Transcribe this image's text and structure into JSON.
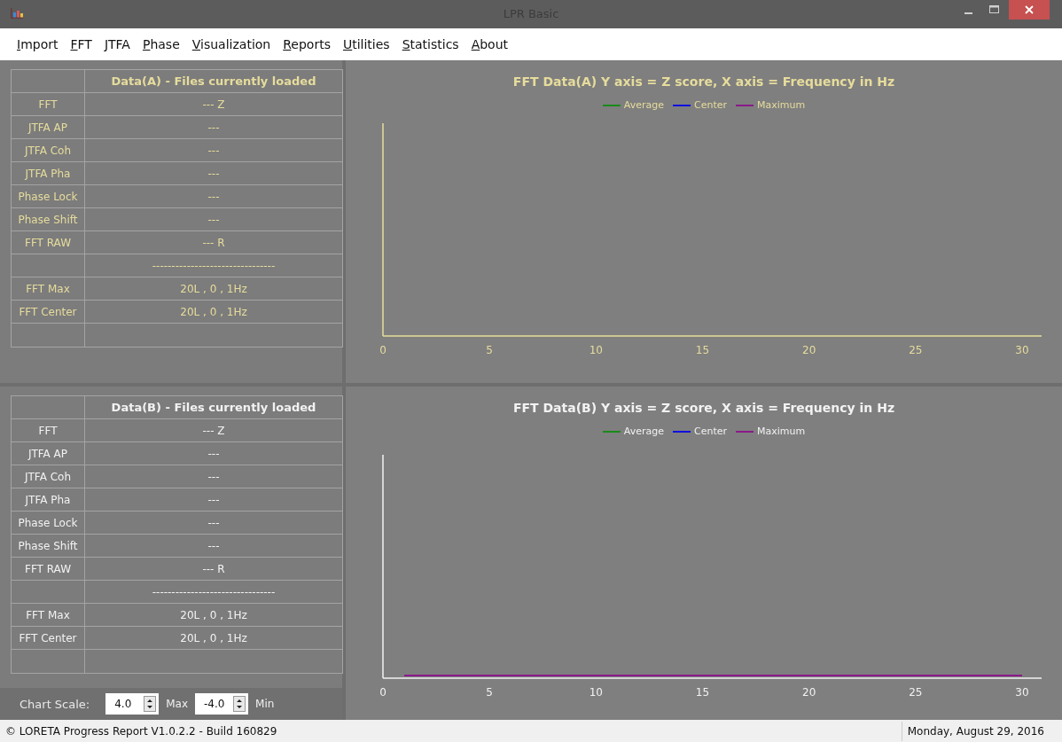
{
  "window": {
    "title": "LPR Basic"
  },
  "menu": [
    "Import",
    "FFT",
    "JTFA",
    "Phase",
    "Visualization",
    "Reports",
    "Utilities",
    "Statistics",
    "About"
  ],
  "panels": [
    {
      "color": "#e6dc9c",
      "table": {
        "header": "Data(A) - Files currently loaded",
        "rows": [
          {
            "label": "FFT",
            "value": "--- Z"
          },
          {
            "label": "JTFA AP",
            "value": "---"
          },
          {
            "label": "JTFA Coh",
            "value": "---"
          },
          {
            "label": "JTFA Pha",
            "value": "---"
          },
          {
            "label": "Phase Lock",
            "value": "---"
          },
          {
            "label": "Phase Shift",
            "value": "---"
          },
          {
            "label": "FFT RAW",
            "value": "--- R"
          },
          {
            "value": "--------------------------------"
          },
          {
            "label": "FFT Max",
            "value": "20L , 0 , 1Hz"
          },
          {
            "label": "FFT Center",
            "value": "20L , 0 , 1Hz"
          }
        ]
      },
      "chart": {
        "title": "FFT Data(A) Y axis = Z score, X axis = Frequency in Hz",
        "x_labels": [
          "0",
          "5",
          "10",
          "15",
          "20",
          "25",
          "30"
        ],
        "legend": [
          {
            "name": "Average",
            "color": "#1a8a1a",
            "trace": false
          },
          {
            "name": "Center",
            "color": "#1010e0",
            "trace": false
          },
          {
            "name": "Maximum",
            "color": "#8a1a8a",
            "trace": false
          }
        ]
      }
    },
    {
      "color": "#f2f2f2",
      "table": {
        "header": "Data(B) - Files currently loaded",
        "rows": [
          {
            "label": "FFT",
            "value": "--- Z"
          },
          {
            "label": "JTFA AP",
            "value": "---"
          },
          {
            "label": "JTFA Coh",
            "value": "---"
          },
          {
            "label": "JTFA Pha",
            "value": "---"
          },
          {
            "label": "Phase Lock",
            "value": "---"
          },
          {
            "label": "Phase Shift",
            "value": "---"
          },
          {
            "label": "FFT RAW",
            "value": "--- R"
          },
          {
            "value": "--------------------------------"
          },
          {
            "label": "FFT Max",
            "value": "20L , 0 , 1Hz"
          },
          {
            "label": "FFT Center",
            "value": "20L , 0 , 1Hz"
          }
        ]
      },
      "chart": {
        "title": "FFT Data(B) Y axis = Z score, X axis = Frequency in Hz",
        "x_labels": [
          "0",
          "5",
          "10",
          "15",
          "20",
          "25",
          "30"
        ],
        "legend": [
          {
            "name": "Average",
            "color": "#1a8a1a",
            "trace": false
          },
          {
            "name": "Center",
            "color": "#1010e0",
            "trace": false
          },
          {
            "name": "Maximum",
            "color": "#8a1a8a",
            "trace": true
          }
        ]
      }
    }
  ],
  "chart_scale": {
    "label": "Chart Scale:",
    "max": {
      "value": "4.0",
      "label": "Max"
    },
    "min": {
      "value": "-4.0",
      "label": "Min"
    }
  },
  "status_bar": {
    "text": "© LORETA Progress Report V1.0.2.2 - Build 160829",
    "date": "Monday, August 29, 2016"
  }
}
